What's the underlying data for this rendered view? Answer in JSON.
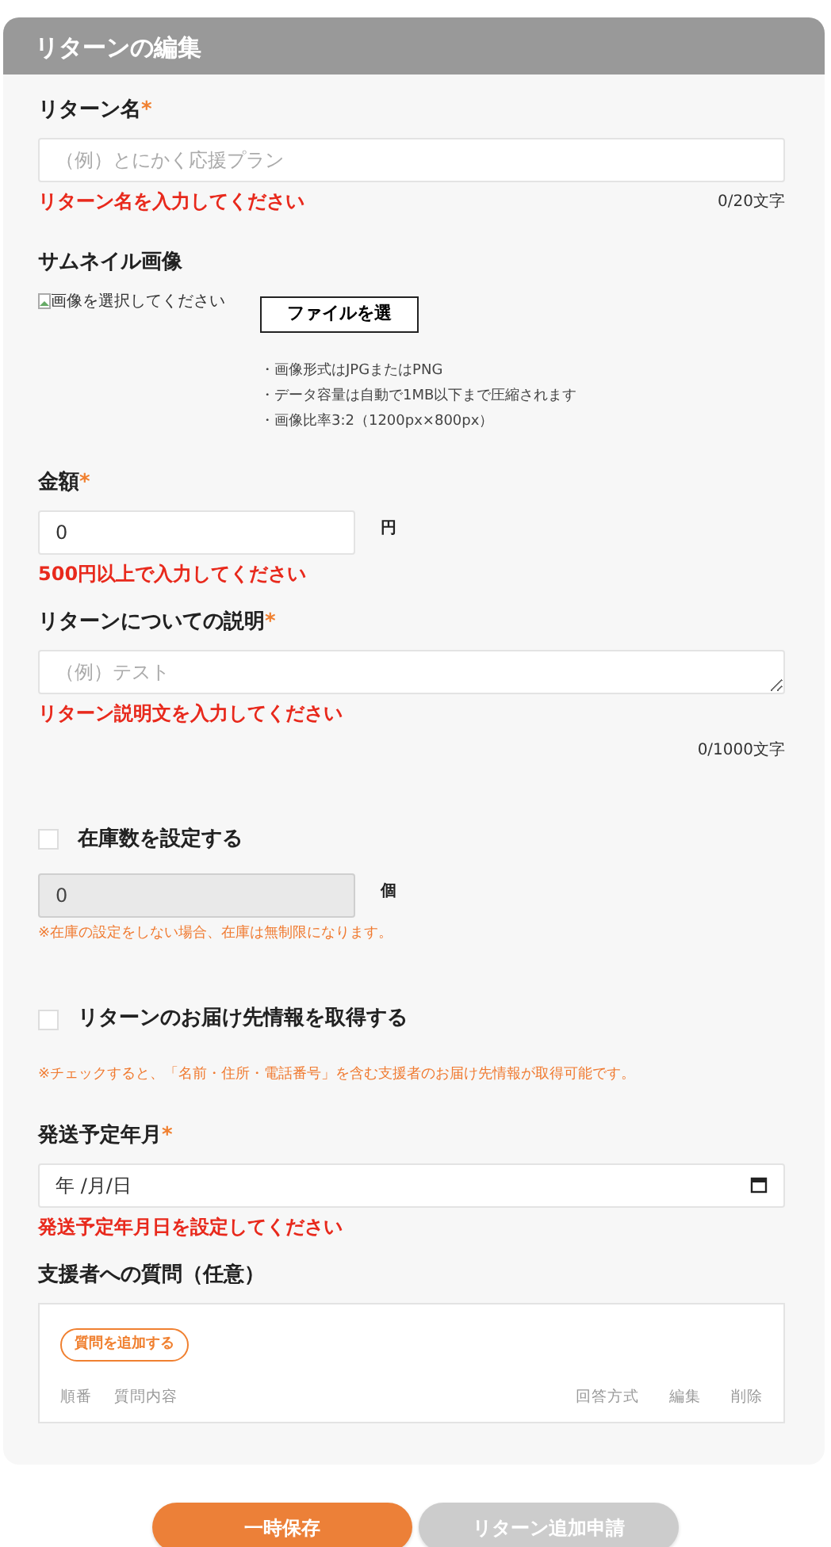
{
  "header": {
    "title": "リターンの編集"
  },
  "sections": [
    {
      "kind": "text",
      "label": "リターン名",
      "required_mark": "*",
      "placeholder": "（例）とにかく応援プラン",
      "error": "リターン名を入力してください",
      "counter": "0/20文字"
    },
    {
      "kind": "image",
      "label": "サムネイル画像",
      "image_alt": "画像を選択してください",
      "button": "ファイルを選",
      "notes": [
        "・画像形式はJPGまたはPNG",
        "・データ容量は自動で1MB以下まで圧縮されます",
        "・画像比率3:2（1200px×800px）"
      ]
    },
    {
      "kind": "number",
      "label": "金額",
      "required_mark": "*",
      "value": "0",
      "unit": "円",
      "disabled": false,
      "error": "500円以上で入力してください"
    },
    {
      "kind": "textarea",
      "label": "リターンについての説明",
      "required_mark": "*",
      "placeholder": "（例）テスト",
      "error": "リターン説明文を入力してください",
      "counter": "0/1000文字"
    },
    {
      "kind": "checkbox",
      "label": "在庫数を設定する",
      "checked": false
    },
    {
      "kind": "number",
      "value": "0",
      "unit": "個",
      "disabled": true,
      "note": "※在庫の設定をしない場合、在庫は無制限になります。"
    },
    {
      "kind": "checkbox",
      "label": "リターンのお届け先情報を取得する",
      "checked": false,
      "note": "※チェックすると、「名前・住所・電話番号」を含む支援者のお届け先情報が取得可能です。"
    },
    {
      "kind": "date",
      "label": "発送予定年月",
      "required_mark": "*",
      "value": "年 /月/日",
      "error": "発送予定年月日を設定してください"
    },
    {
      "kind": "questions",
      "label": "支援者への質問（任意）",
      "button": "質問を追加する",
      "columns": [
        "順番",
        "質問内容",
        "回答方式",
        "編集",
        "削除"
      ]
    }
  ],
  "buttons": [
    {
      "label": "一時保存",
      "disabled": false
    },
    {
      "label": "リターン追加申請",
      "disabled": true
    }
  ]
}
